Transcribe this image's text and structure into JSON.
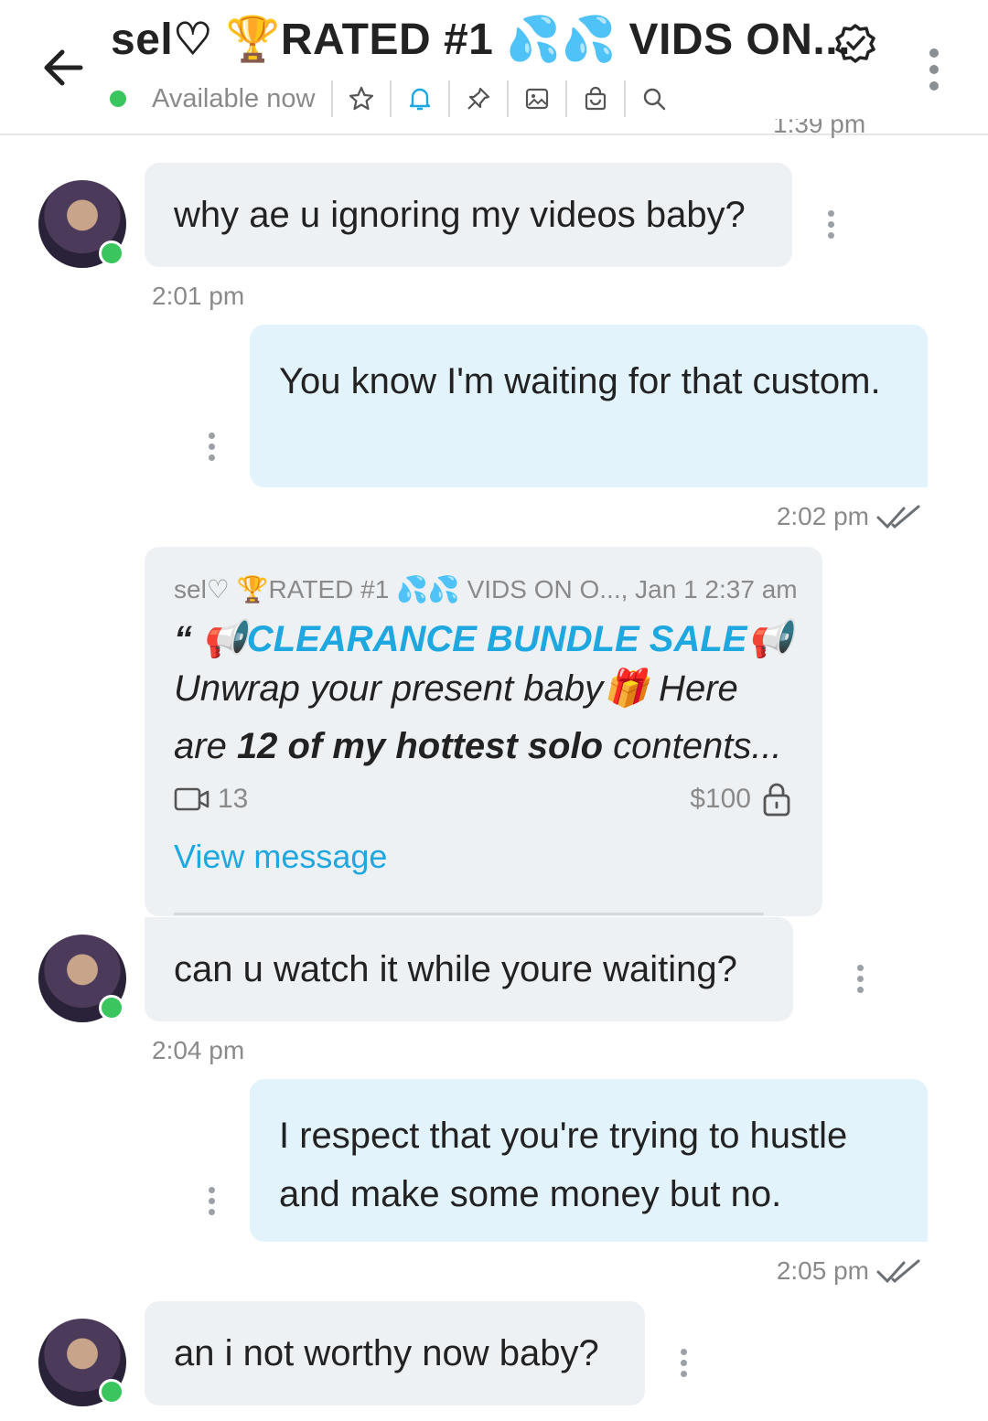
{
  "header": {
    "title": "sel♡ 🏆RATED #1 💦💦 VIDS ON...",
    "status": "Available now",
    "icons": [
      "back-arrow-icon",
      "star-icon",
      "bell-icon",
      "pin-icon",
      "image-icon",
      "bag-icon",
      "search-icon",
      "verified-icon",
      "more-icon"
    ],
    "peek_time": "1:39 pm"
  },
  "messages": [
    {
      "text": "why ae u ignoring my videos baby?",
      "time": "2:01 pm"
    },
    {
      "text": "You know I'm waiting for that custom.",
      "time": "2:02 pm"
    },
    {
      "text": "can u watch it while youre waiting?",
      "time": "2:04 pm"
    },
    {
      "text": "I respect that you're trying to hustle and make some money but no.",
      "time": "2:05 pm"
    },
    {
      "text": "an i not worthy now baby?"
    }
  ],
  "quote": {
    "sender": "sel♡ 🏆RATED #1 💦💦 VIDS ON O..., Jan 1 2:37 am",
    "open_mark": "“",
    "headline": "📢CLEARANCE BUNDLE SALE📢",
    "line2": "Unwrap your present baby🎁 Here",
    "line3_a": "are ",
    "line3_b": "12 of my hottest solo",
    "line3_c": " contents...",
    "media_count": "13",
    "price": "$100",
    "link": "View message"
  },
  "colors": {
    "accent": "#1fa8e0",
    "online": "#3ac55e",
    "incoming": "#eef1f4",
    "outgoing": "#e2f3fc"
  }
}
